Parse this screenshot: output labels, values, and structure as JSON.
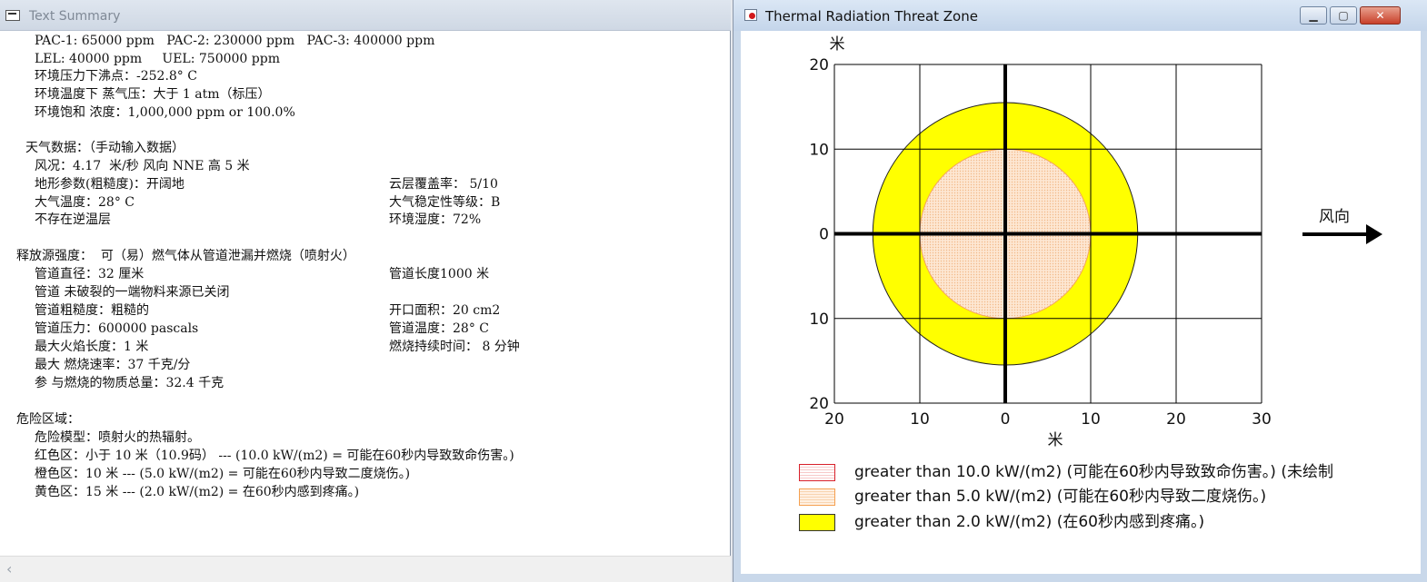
{
  "left_window": {
    "title": "Text Summary",
    "lines": [
      "PAC-1: 65000 ppm   PAC-2: 230000 ppm   PAC-3: 400000 ppm",
      "LEL: 40000 ppm     UEL: 750000 ppm",
      "环境压力下沸点：-252.8° C",
      "环境温度下 蒸气压：大于 1 atm（标压）",
      "环境饱和 浓度：1,000,000 ppm or 100.0%",
      "天气数据：（手动输入数据）",
      "风况：4.17  米/秒 风向 NNE 高 5 米",
      "地形参数(粗糙度)：开阔地",
      "云层覆盖率： 5/10",
      "大气温度：28° C",
      "大气稳定性等级：B",
      "不存在逆温层",
      "环境湿度：72%",
      "释放源强度：  可（易）燃气体从管道泄漏并燃烧（喷射火）",
      "管道直径：32 厘米",
      "管道长度1000 米",
      "管道 未破裂的一端物料来源已关闭",
      "管道粗糙度：粗糙的",
      "开口面积：20 cm2",
      "管道压力：600000 pascals",
      "管道温度：28° C",
      "最大火焰长度：1 米",
      "燃烧持续时间： 8 分钟",
      "最大 燃烧速率：37 千克/分",
      "参 与燃烧的物质总量：32.4 千克",
      "危险区域：",
      "危险模型：喷射火的热辐射。",
      "红色区：小于 10 米（10.9码） --- (10.0 kW/(m2) = 可能在60秒内导致致命伤害。)",
      "橙色区：10 米 --- (5.0 kW/(m2) = 可能在60秒内导致二度烧伤。)",
      "黄色区：15 米 --- (2.0 kW/(m2) = 在60秒内感到疼痛。)"
    ],
    "scroll_left_glyph": "‹"
  },
  "right_window": {
    "title": "Thermal Radiation Threat Zone",
    "buttons": {
      "minimize": "▁",
      "maximize": "▢",
      "close": "✕"
    },
    "wind_label": "风向",
    "axis_unit": "米",
    "legend": [
      {
        "text": "greater than 10.0 kW/(m2) (可能在60秒内导致致命伤害。) (未绘制",
        "color": "#d8202a"
      },
      {
        "text": "greater than 5.0 kW/(m2) (可能在60秒内导致二度烧伤。)",
        "color": "#f5a050"
      },
      {
        "text": "greater than 2.0 kW/(m2) (在60秒内感到疼痛。)",
        "color": "#ffff00"
      }
    ]
  },
  "chart_data": {
    "type": "area",
    "title": "Thermal Radiation Threat Zone",
    "xlabel": "米",
    "ylabel": "米",
    "x_ticks": [
      "20",
      "10",
      "0",
      "10",
      "20",
      "30"
    ],
    "y_ticks": [
      "20",
      "10",
      "0",
      "10",
      "20"
    ],
    "xlim": [
      -20,
      30
    ],
    "ylim": [
      -20,
      20
    ],
    "grid": true,
    "zones": [
      {
        "name": "greater than 5.0 kW/(m2)",
        "radius": 10,
        "color": "#fde2c8"
      },
      {
        "name": "greater than 2.0 kW/(m2)",
        "radius": 15.5,
        "color": "#ffff00"
      }
    ],
    "wind_direction_label": "风向"
  }
}
